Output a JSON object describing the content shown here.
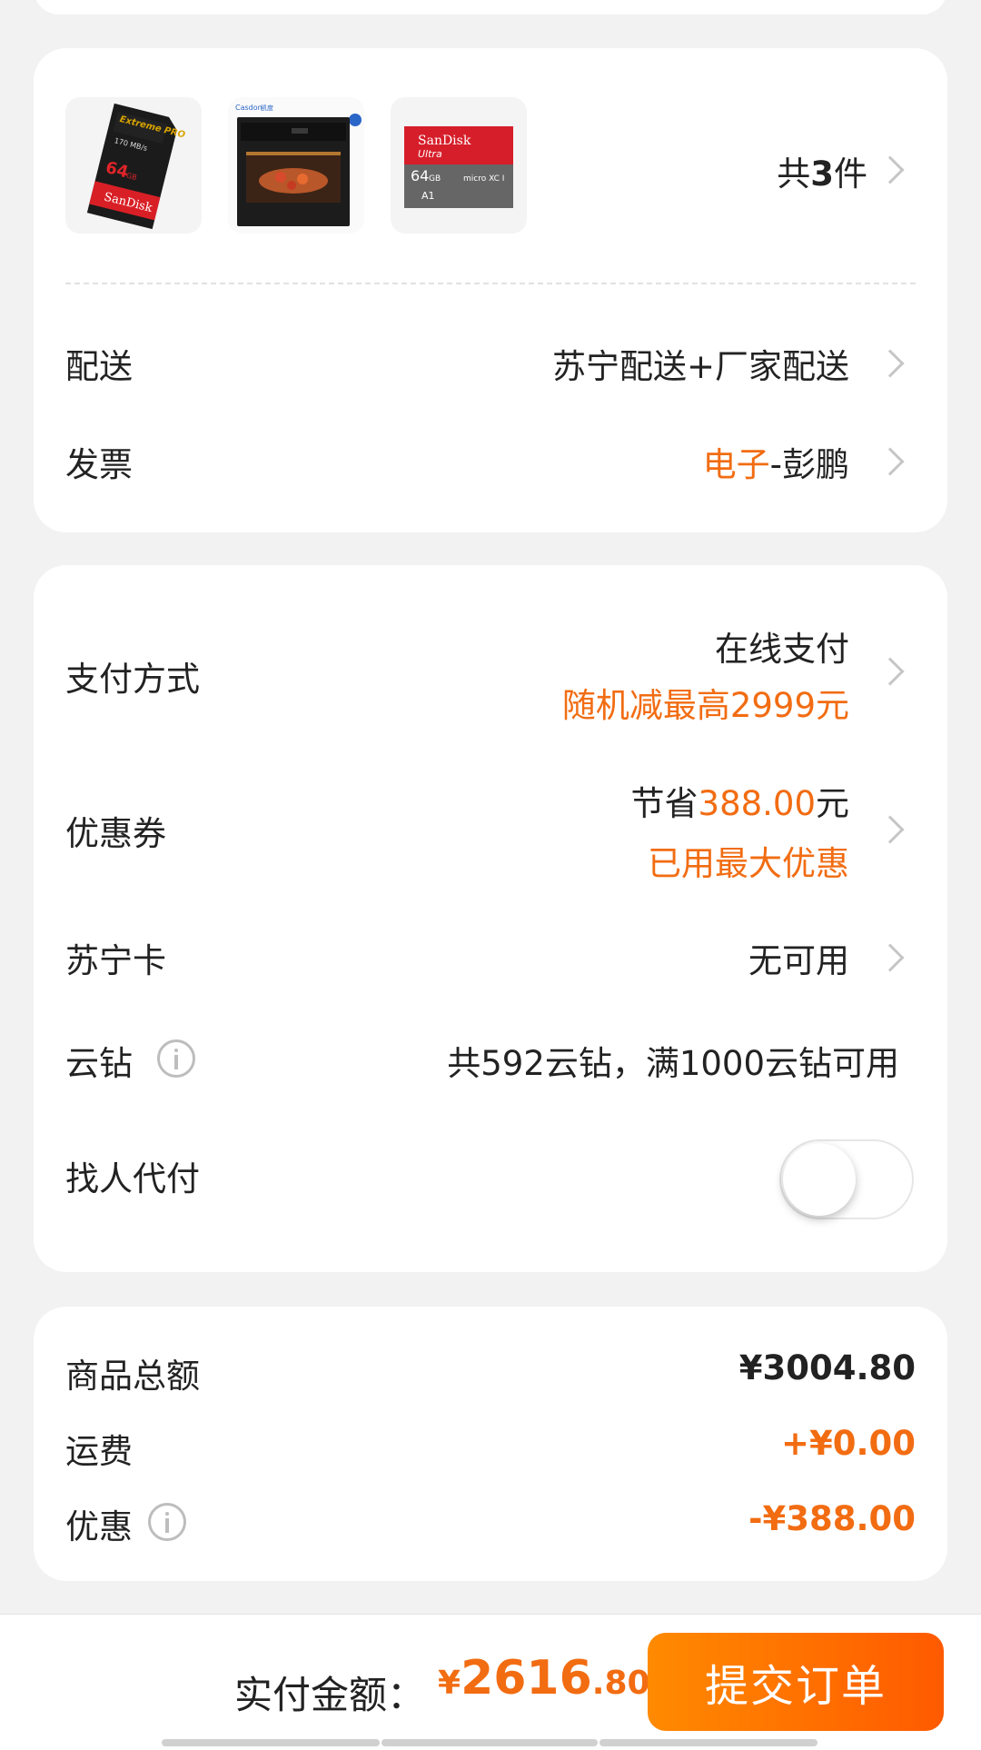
{
  "goods": {
    "thumbnails": [
      {
        "name": "sandisk-extreme-pro-sd-card",
        "brand": "SanDisk",
        "model": "Extreme PRO",
        "capacity": "64",
        "unit": "GB",
        "speed": "170 MB/s"
      },
      {
        "name": "casdon-steam-oven",
        "brand": "Casdon",
        "brand_cn": "凯度"
      },
      {
        "name": "sandisk-ultra-microsd-card",
        "brand": "SanDisk",
        "model": "Ultra",
        "capacity": "64",
        "unit": "GB",
        "class": "A1"
      }
    ],
    "count_prefix": "共",
    "count_num": "3",
    "count_suffix": "件"
  },
  "delivery": {
    "label": "配送",
    "value": "苏宁配送+厂家配送"
  },
  "invoice": {
    "label": "发票",
    "type": "电子",
    "name": "-彭鹏"
  },
  "payment": {
    "label": "支付方式",
    "method": "在线支付",
    "promo": "随机减最高2999元"
  },
  "coupon": {
    "label": "优惠券",
    "save_prefix": "节省",
    "save_amount": "388.00",
    "save_suffix": "元",
    "status": "已用最大优惠"
  },
  "suning_card": {
    "label": "苏宁卡",
    "value": "无可用"
  },
  "yunzuan": {
    "label": "云钻",
    "value": "共592云钻，满1000云钻可用"
  },
  "proxy_pay": {
    "label": "找人代付",
    "enabled": false
  },
  "summary": {
    "goods_total_label": "商品总额",
    "goods_total": "¥3004.80",
    "shipping_label": "运费",
    "shipping": "+¥0.00",
    "discount_label": "优惠",
    "discount": "-¥388.00"
  },
  "footer": {
    "total_label": "实付金额：",
    "currency": "¥",
    "amount_int": "2616",
    "amount_dec": ".80",
    "submit_label": "提交订单"
  },
  "colors": {
    "accent": "#f26c12",
    "button_start": "#ff8a00",
    "button_end": "#ff5a00"
  }
}
